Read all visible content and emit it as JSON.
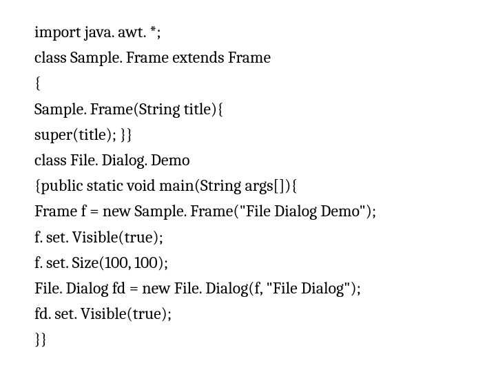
{
  "code": {
    "lines": [
      "import java. awt. *;",
      "class Sample. Frame extends Frame",
      "{",
      "Sample. Frame(String title){",
      "super(title); }}",
      "class File. Dialog. Demo",
      "{public static void main(String args[]){",
      "Frame f = new Sample. Frame(\"File Dialog Demo\");",
      "f. set. Visible(true);",
      "f. set. Size(100, 100);",
      "File. Dialog fd = new File. Dialog(f, \"File Dialog\");",
      "fd. set. Visible(true);",
      "}}"
    ]
  }
}
